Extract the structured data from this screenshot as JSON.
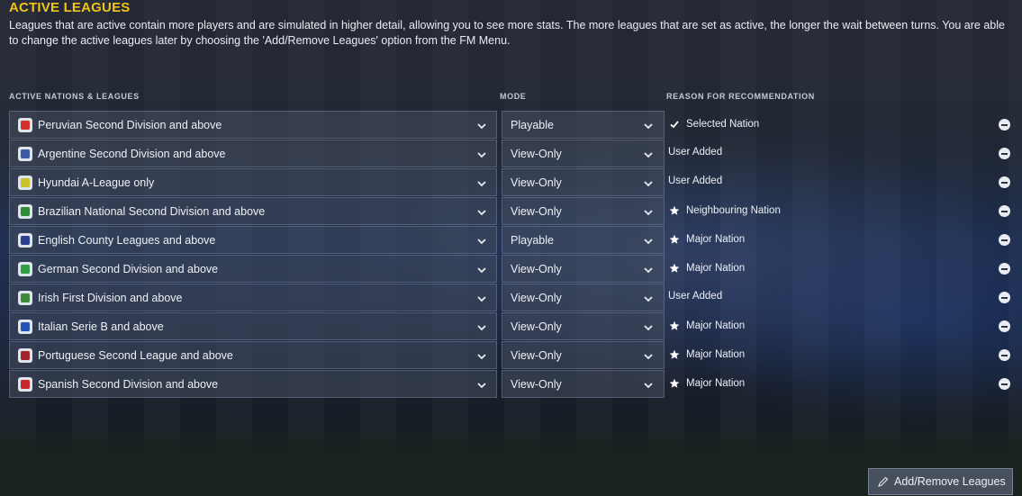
{
  "page": {
    "title": "ACTIVE LEAGUES",
    "intro": "Leagues that are active contain more players and are simulated in higher detail, allowing you to see more stats. The more leagues that are set as active, the longer the wait between turns. You are able to change the active leagues later by choosing the 'Add/Remove Leagues' option from the FM Menu."
  },
  "columns": {
    "league": "ACTIVE NATIONS & LEAGUES",
    "mode": "MODE",
    "reason": "REASON FOR RECOMMENDATION"
  },
  "colors": {
    "title": "#f0c419",
    "panel": "#464e60"
  },
  "rows": [
    {
      "league": "Peruvian Second Division and above",
      "mode": "Playable",
      "reason": "Selected Nation",
      "reason_icon": "check-icon",
      "badge_color": "#d32f2f"
    },
    {
      "league": "Argentine Second Division and above",
      "mode": "View-Only",
      "reason": "User Added",
      "reason_icon": "",
      "badge_color": "#3c5aa8"
    },
    {
      "league": "Hyundai A-League only",
      "mode": "View-Only",
      "reason": "User Added",
      "reason_icon": "",
      "badge_color": "#c9c22a"
    },
    {
      "league": "Brazilian National Second Division and above",
      "mode": "View-Only",
      "reason": "Neighbouring Nation",
      "reason_icon": "star-icon",
      "badge_color": "#2e8b3a"
    },
    {
      "league": "English County Leagues and above",
      "mode": "Playable",
      "reason": "Major Nation",
      "reason_icon": "star-icon",
      "badge_color": "#2b3f8f"
    },
    {
      "league": "German Second Division and above",
      "mode": "View-Only",
      "reason": "Major Nation",
      "reason_icon": "star-icon",
      "badge_color": "#2f9e47"
    },
    {
      "league": "Irish First Division and above",
      "mode": "View-Only",
      "reason": "User Added",
      "reason_icon": "",
      "badge_color": "#3a8a3a"
    },
    {
      "league": "Italian Serie B and above",
      "mode": "View-Only",
      "reason": "Major Nation",
      "reason_icon": "star-icon",
      "badge_color": "#2451b8"
    },
    {
      "league": "Portuguese Second League and above",
      "mode": "View-Only",
      "reason": "Major Nation",
      "reason_icon": "star-icon",
      "badge_color": "#a3242b"
    },
    {
      "league": "Spanish Second Division and above",
      "mode": "View-Only",
      "reason": "Major Nation",
      "reason_icon": "star-icon",
      "badge_color": "#c8262a"
    }
  ],
  "footer": {
    "add_remove_label": "Add/Remove Leagues"
  }
}
